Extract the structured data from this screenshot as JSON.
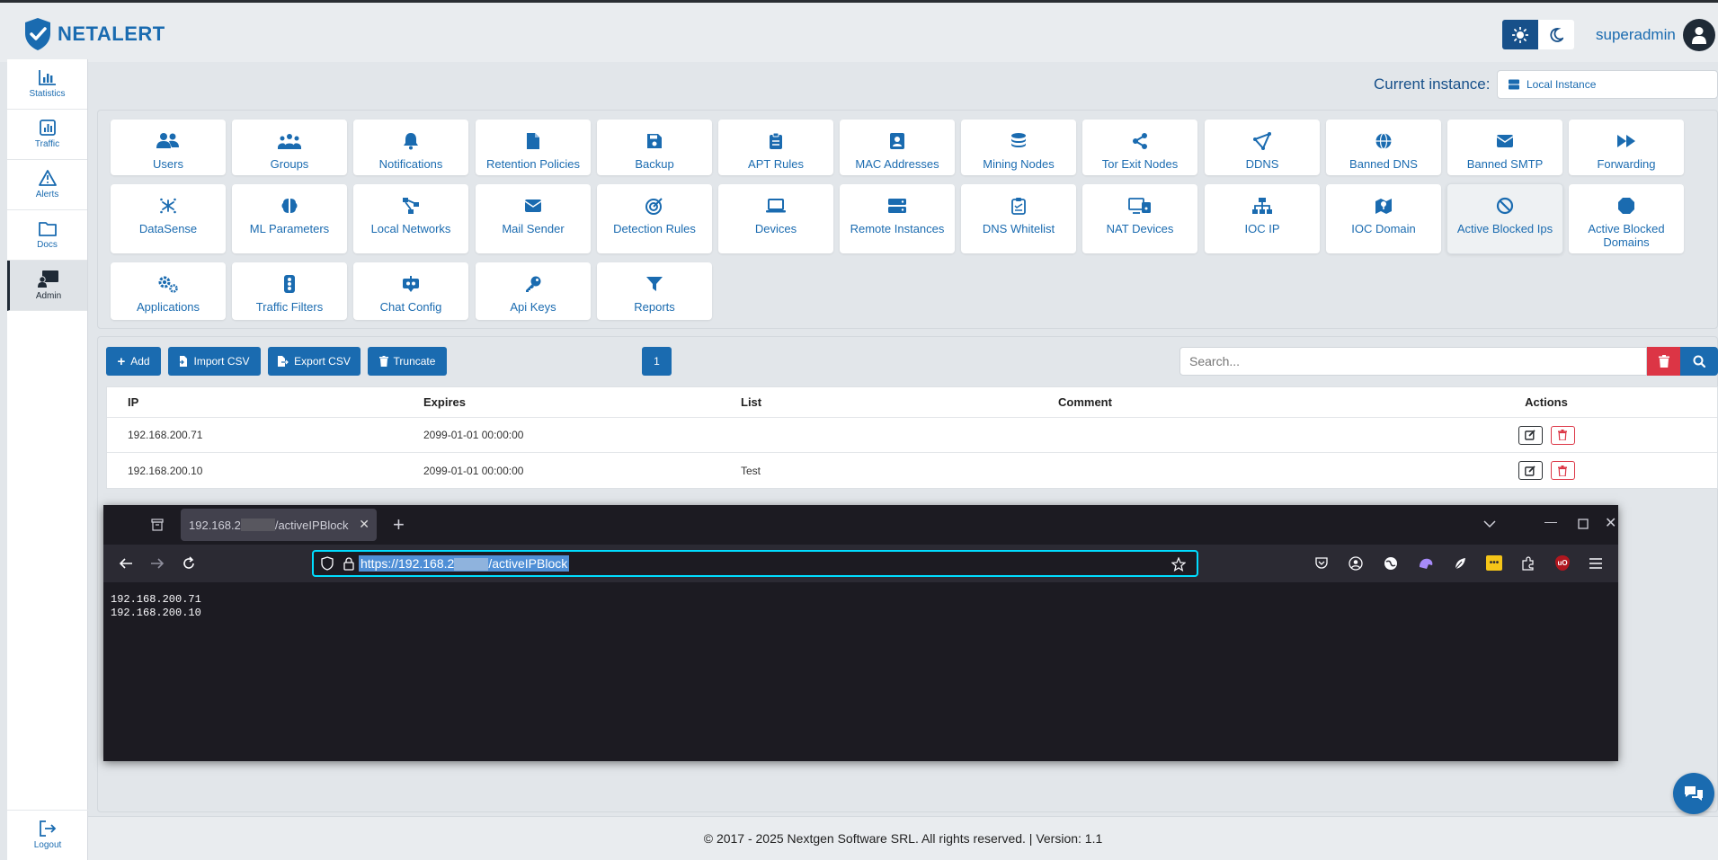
{
  "app": {
    "logo_text": "NETALERT"
  },
  "header": {
    "username": "superadmin"
  },
  "sidebar": {
    "items": [
      {
        "label": "Statistics",
        "icon": "chart-bar-icon"
      },
      {
        "label": "Traffic",
        "icon": "chart-square-icon"
      },
      {
        "label": "Alerts",
        "icon": "warning-triangle-icon"
      },
      {
        "label": "Docs",
        "icon": "folder-icon"
      },
      {
        "label": "Admin",
        "icon": "admin-screen-icon",
        "active": true
      }
    ],
    "logout_label": "Logout"
  },
  "instance": {
    "label": "Current instance:",
    "value": "Local Instance"
  },
  "tiles": [
    {
      "label": "Users",
      "icon": "users-icon"
    },
    {
      "label": "Groups",
      "icon": "groups-icon"
    },
    {
      "label": "Notifications",
      "icon": "bell-icon"
    },
    {
      "label": "Retention Policies",
      "icon": "file-icon"
    },
    {
      "label": "Backup",
      "icon": "save-icon"
    },
    {
      "label": "APT Rules",
      "icon": "clipboard-icon"
    },
    {
      "label": "MAC Addresses",
      "icon": "address-card-icon"
    },
    {
      "label": "Mining Nodes",
      "icon": "coins-icon"
    },
    {
      "label": "Tor Exit Nodes",
      "icon": "share-icon"
    },
    {
      "label": "DDNS",
      "icon": "nodes-icon"
    },
    {
      "label": "Banned DNS",
      "icon": "globe-icon"
    },
    {
      "label": "Banned SMTP",
      "icon": "envelope-icon"
    },
    {
      "label": "Forwarding",
      "icon": "forward-icon"
    },
    {
      "label": "DataSense",
      "icon": "sparkle-icon"
    },
    {
      "label": "ML Parameters",
      "icon": "brain-icon"
    },
    {
      "label": "Local Networks",
      "icon": "network-icon"
    },
    {
      "label": "Mail Sender",
      "icon": "envelope-icon"
    },
    {
      "label": "Detection Rules",
      "icon": "target-icon"
    },
    {
      "label": "Devices",
      "icon": "laptop-icon"
    },
    {
      "label": "Remote Instances",
      "icon": "server-icon"
    },
    {
      "label": "DNS Whitelist",
      "icon": "clipboard-check-icon"
    },
    {
      "label": "NAT Devices",
      "icon": "devices-icon"
    },
    {
      "label": "IOC IP",
      "icon": "sitemap-icon"
    },
    {
      "label": "IOC Domain",
      "icon": "map-icon"
    },
    {
      "label": "Active Blocked Ips",
      "icon": "ban-icon",
      "selected": true
    },
    {
      "label": "Active Blocked Domains",
      "icon": "stop-icon"
    },
    {
      "label": "Applications",
      "icon": "cogs-icon"
    },
    {
      "label": "Traffic Filters",
      "icon": "traffic-light-icon"
    },
    {
      "label": "Chat Config",
      "icon": "robot-icon"
    },
    {
      "label": "Api Keys",
      "icon": "key-icon"
    },
    {
      "label": "Reports",
      "icon": "filter-icon"
    }
  ],
  "toolbar": {
    "add": "Add",
    "import": "Import CSV",
    "export": "Export CSV",
    "truncate": "Truncate",
    "page": "1",
    "search_placeholder": "Search..."
  },
  "table": {
    "columns": [
      "IP",
      "Expires",
      "List",
      "Comment",
      "Actions"
    ],
    "rows": [
      {
        "ip": "192.168.200.71",
        "expires": "2099-01-01 00:00:00",
        "list": "",
        "comment": ""
      },
      {
        "ip": "192.168.200.10",
        "expires": "2099-01-01 00:00:00",
        "list": "Test",
        "comment": ""
      }
    ]
  },
  "browser": {
    "tab_title_prefix": "192.168.2",
    "tab_title_suffix": "/activeIPBlock",
    "url_prefix": "https://192.168.2",
    "url_suffix": "/activeIPBlock",
    "content_lines": [
      "192.168.200.71",
      "192.168.200.10"
    ]
  },
  "footer": {
    "text": "© 2017 - 2025 Nextgen Software SRL. All rights reserved. | Version: 1.1"
  },
  "colors": {
    "primary": "#1a6bb0",
    "danger": "#dc3545",
    "dark": "#1f2a36"
  }
}
